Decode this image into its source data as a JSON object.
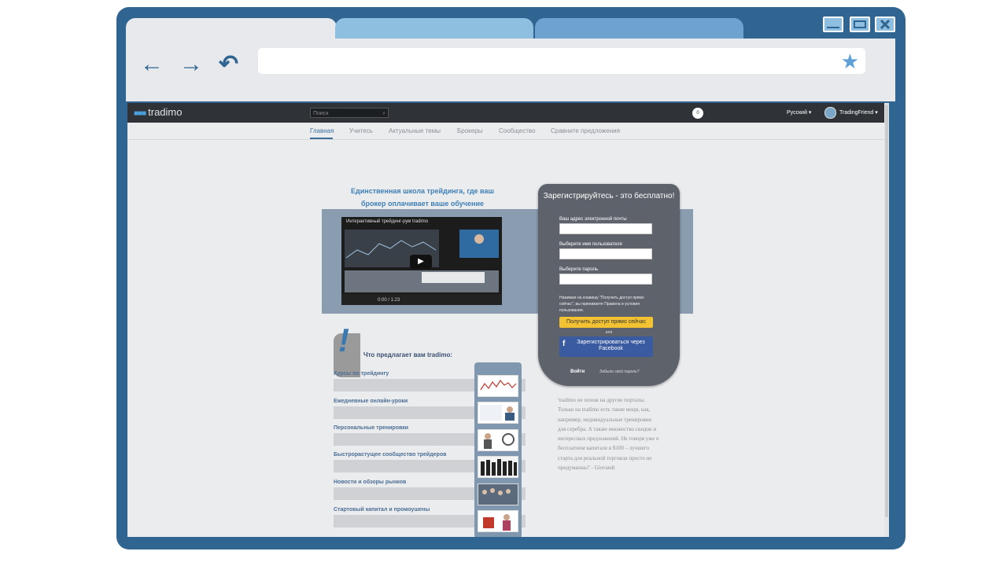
{
  "window": {
    "controls": [
      "minimize-icon",
      "maximize-icon",
      "close-icon"
    ]
  },
  "toolbar": {
    "back_icon": "←",
    "forward_icon": "→",
    "reload_icon": "↶",
    "bookmark_icon": "★"
  },
  "site": {
    "logo": "tradimo",
    "search_placeholder": "Поиск",
    "notifications": "0",
    "language": "Русский ▾",
    "username": "TradingFriend ▾"
  },
  "nav": {
    "items": [
      "Главная",
      "Учитесь",
      "Актуальные темы",
      "Брокеры",
      "Сообщество",
      "Сравните предложения"
    ]
  },
  "hero": {
    "headline": "Единственная школа трейдинга, где ваш брокер оплачивает ваше обучение",
    "video_title": "Интерактивный трейдинг-рум tradimo",
    "video_time": "0:00 / 1:23"
  },
  "register": {
    "title": "Зарегистрируйтесь - это бесплатно!",
    "email_label": "Ваш адрес электронной почты",
    "username_label": "Выберите имя пользователя",
    "password_label": "Выберите пароль",
    "terms": "Нажимая на клавишу \"Получить доступ прямо сейчас\", вы принимаете Правила и условия пользования.",
    "cta": "Получить доступ прямо сейчас",
    "or": "или",
    "facebook": "Зарегистрироваться через Facebook",
    "login": "Войти",
    "forgot": "Забыли свой пароль?"
  },
  "offers": {
    "title": "Что предлагает вам tradimo:",
    "items": [
      "Курсы по трейдингу",
      "Ежедневные онлайн-уроки",
      "Персональные тренировки",
      "Быстрорастущее сообщество трейдеров",
      "Новости и обзоры рынков",
      "Стартовый капитал и промоушены"
    ]
  },
  "testimonial": "'tradimo не похож на другие порталы. Только на tradimo есть такие вещи, как, например, индивидуальные тренировки для серебра. А также множество скидок и интересных предложений. Не говоря уже о бесплатном капитале в $100 – лучшего старта для реальной торговли просто не придумаешь!' - Giovandi",
  "colors": {
    "frame": "#2f6590",
    "accent": "#3f7fb5",
    "cta": "#f3c233",
    "facebook": "#3a5ba0"
  }
}
